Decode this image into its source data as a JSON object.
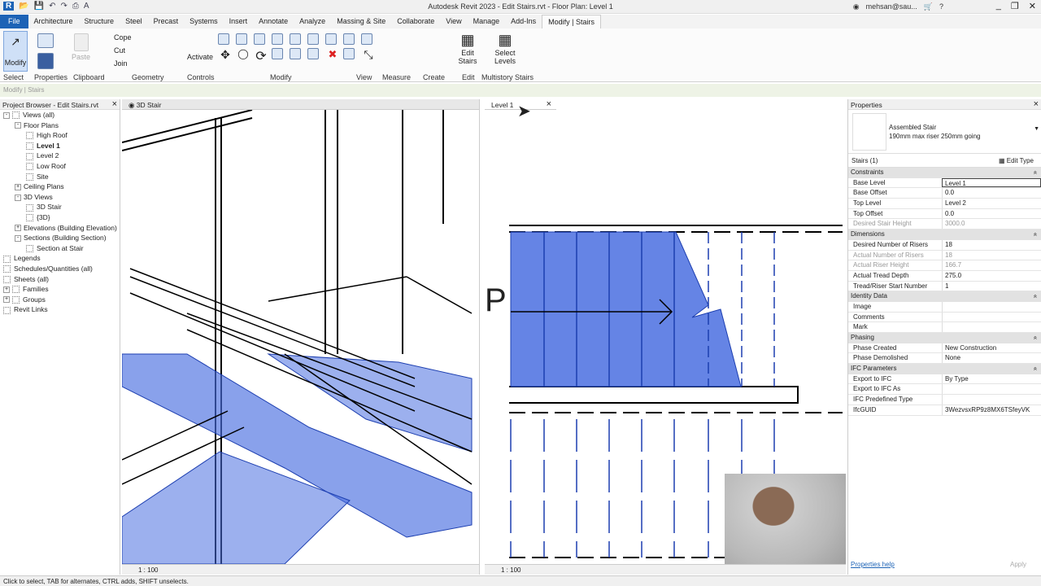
{
  "app": {
    "title": "Autodesk Revit 2023 - Edit Stairs.rvt - Floor Plan: Level 1",
    "user": "mehsan@sau...",
    "logo": "R"
  },
  "tabs": [
    "File",
    "Architecture",
    "Structure",
    "Steel",
    "Precast",
    "Systems",
    "Insert",
    "Annotate",
    "Analyze",
    "Massing & Site",
    "Collaborate",
    "View",
    "Manage",
    "Add-Ins",
    "Modify | Stairs"
  ],
  "ribbon": {
    "tools": {
      "modify": "Modify",
      "paste": "Paste",
      "cope": "Cope",
      "cut": "Cut",
      "join": "Join",
      "activate": "Activate",
      "edit_stairs": "Edit Stairs",
      "select_levels": "Select Levels"
    },
    "panels": [
      "Select",
      "Properties",
      "Clipboard",
      "Geometry",
      "Controls",
      "Modify",
      "View",
      "Measure",
      "Create",
      "Edit",
      "Multistory Stairs"
    ]
  },
  "context_bar": "Modify | Stairs",
  "browser": {
    "title": "Project Browser - Edit Stairs.rvt",
    "items": [
      {
        "label": "Views (all)",
        "level": 0,
        "toggle": "-"
      },
      {
        "label": "Floor Plans",
        "level": 1,
        "toggle": "-"
      },
      {
        "label": "High Roof",
        "level": 2
      },
      {
        "label": "Level 1",
        "level": 2,
        "bold": true
      },
      {
        "label": "Level 2",
        "level": 2
      },
      {
        "label": "Low Roof",
        "level": 2
      },
      {
        "label": "Site",
        "level": 2
      },
      {
        "label": "Ceiling Plans",
        "level": 1,
        "toggle": "+"
      },
      {
        "label": "3D Views",
        "level": 1,
        "toggle": "-"
      },
      {
        "label": "3D Stair",
        "level": 2
      },
      {
        "label": "{3D}",
        "level": 2
      },
      {
        "label": "Elevations (Building Elevation)",
        "level": 1,
        "toggle": "+"
      },
      {
        "label": "Sections (Building Section)",
        "level": 1,
        "toggle": "-"
      },
      {
        "label": "Section at Stair",
        "level": 2
      },
      {
        "label": "Legends",
        "level": 0
      },
      {
        "label": "Schedules/Quantities (all)",
        "level": 0
      },
      {
        "label": "Sheets (all)",
        "level": 0
      },
      {
        "label": "Families",
        "level": 0,
        "toggle": "+"
      },
      {
        "label": "Groups",
        "level": 0,
        "toggle": "+"
      },
      {
        "label": "Revit Links",
        "level": 0
      }
    ]
  },
  "view3d": {
    "tab": "3D Stair",
    "scale": "1 : 100"
  },
  "viewplan": {
    "tab": "Level 1",
    "scale": "1 : 100",
    "label": "P"
  },
  "properties": {
    "title": "Properties",
    "type_name": "Assembled Stair",
    "type_desc": "190mm max riser 250mm going",
    "selector": "Stairs (1)",
    "edit_type": "Edit Type",
    "groups": [
      {
        "name": "Constraints",
        "rows": [
          [
            "Base Level",
            "Level 1"
          ],
          [
            "Base Offset",
            "0.0"
          ],
          [
            "Top Level",
            "Level 2"
          ],
          [
            "Top Offset",
            "0.0"
          ],
          [
            "Desired Stair Height",
            "3000.0",
            true
          ]
        ]
      },
      {
        "name": "Dimensions",
        "rows": [
          [
            "Desired Number of Risers",
            "18"
          ],
          [
            "Actual Number of Risers",
            "18",
            true
          ],
          [
            "Actual Riser Height",
            "166.7",
            true
          ],
          [
            "Actual Tread Depth",
            "275.0"
          ],
          [
            "Tread/Riser Start Number",
            "1"
          ]
        ]
      },
      {
        "name": "Identity Data",
        "rows": [
          [
            "Image",
            ""
          ],
          [
            "Comments",
            ""
          ],
          [
            "Mark",
            ""
          ]
        ]
      },
      {
        "name": "Phasing",
        "rows": [
          [
            "Phase Created",
            "New Construction"
          ],
          [
            "Phase Demolished",
            "None"
          ]
        ]
      },
      {
        "name": "IFC Parameters",
        "rows": [
          [
            "Export to IFC",
            "By Type"
          ],
          [
            "Export to IFC As",
            ""
          ],
          [
            "IFC Predefined Type",
            ""
          ],
          [
            "IfcGUID",
            "3WezvsxRP9z8MX6TSfeyVK"
          ]
        ]
      }
    ],
    "help": "Properties help",
    "apply": "Apply"
  },
  "status": "Click to select, TAB for alternates, CTRL adds, SHIFT unselects.",
  "colors": {
    "selection": "#4a6fe0",
    "file_tab": "#1d63b6"
  }
}
